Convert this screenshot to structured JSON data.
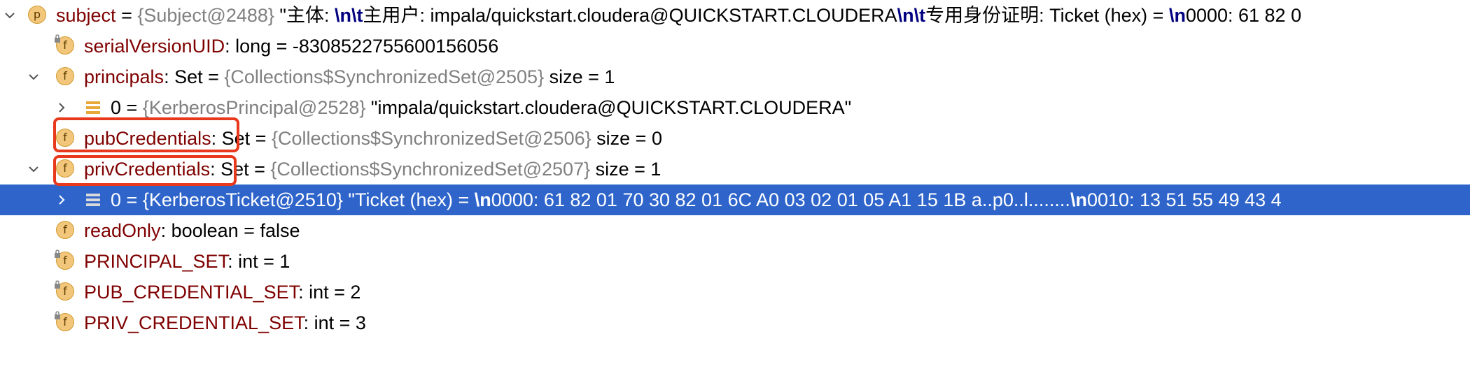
{
  "tree": {
    "subject": {
      "badge": "p",
      "name": "subject",
      "eq": " = ",
      "ref": "{Subject@2488}",
      "value_prefix": " \"主体: ",
      "esc1": "\\n\\t",
      "value_mid": "主用户: impala/quickstart.cloudera@QUICKSTART.CLOUDERA",
      "esc2": "\\n\\t",
      "value_mid2": "专用身份证明: Ticket (hex) = ",
      "esc3": "\\n",
      "value_end": "0000: 61 82 0"
    },
    "serialVersionUID": {
      "badge": "f",
      "name": "serialVersionUID",
      "type": ": long  = ",
      "value": "-8308522755600156056"
    },
    "principals": {
      "badge": "f",
      "name": "principals",
      "type": ": Set  = ",
      "ref": "{Collections$SynchronizedSet@2505}",
      "size": "  size = 1"
    },
    "principal_item": {
      "index": "0",
      "eq": " = ",
      "ref": "{KerberosPrincipal@2528}",
      "value": " \"impala/quickstart.cloudera@QUICKSTART.CLOUDERA\""
    },
    "pubCredentials": {
      "badge": "f",
      "name": "pubCredentials",
      "type": ": Set  = ",
      "ref": "{Collections$SynchronizedSet@2506}",
      "size": "  size = 0"
    },
    "privCredentials": {
      "badge": "f",
      "name": "privCredentials",
      "type": ": Set  = ",
      "ref": "{Collections$SynchronizedSet@2507}",
      "size": "  size = 1"
    },
    "ticket_item": {
      "index": "0",
      "eq": " = ",
      "ref": "{KerberosTicket@2510}",
      "value_prefix": " \"Ticket (hex) = ",
      "esc1": "\\n",
      "value_mid": "0000: 61 82 01 70 30 82 01 6C   A0 03 02 01 05 A1 15 1B  a..p0..l........",
      "esc2": "\\n",
      "value_end": "0010: 13 51 55 49 43 4"
    },
    "readOnly": {
      "badge": "f",
      "name": "readOnly",
      "type": ": boolean  = ",
      "value": "false"
    },
    "PRINCIPAL_SET": {
      "badge": "f",
      "name": "PRINCIPAL_SET",
      "type": ": int  = ",
      "value": "1"
    },
    "PUB_CREDENTIAL_SET": {
      "badge": "f",
      "name": "PUB_CREDENTIAL_SET",
      "type": ": int  = ",
      "value": "2"
    },
    "PRIV_CREDENTIAL_SET": {
      "badge": "f",
      "name": "PRIV_CREDENTIAL_SET",
      "type": ": int  = ",
      "value": "3"
    }
  },
  "colors": {
    "selection": "#2f65ca",
    "highlight_box": "#e8391d",
    "field_name": "#871094",
    "field_name_static": "#7f0000",
    "ref_gray": "#808080"
  }
}
